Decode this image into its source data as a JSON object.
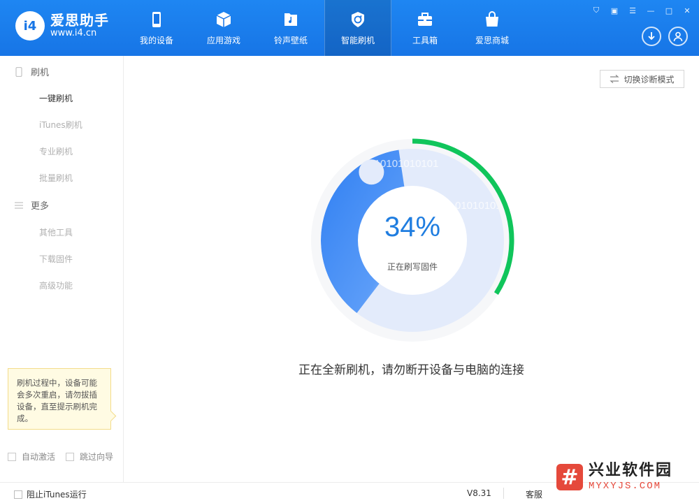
{
  "app": {
    "brand": "爱思助手",
    "url": "www.i4.cn",
    "logo_mark": "i4",
    "accent": "#1775e6"
  },
  "nav": {
    "tabs": [
      {
        "label": "我的设备",
        "icon": "phone-icon"
      },
      {
        "label": "应用游戏",
        "icon": "cube-icon"
      },
      {
        "label": "铃声壁纸",
        "icon": "music-file-icon"
      },
      {
        "label": "智能刷机",
        "icon": "refresh-shield-icon",
        "active": true
      },
      {
        "label": "工具箱",
        "icon": "toolbox-icon"
      },
      {
        "label": "爱思商城",
        "icon": "shopping-bag-icon"
      }
    ]
  },
  "window_controls": [
    "shirt-icon",
    "note-icon",
    "menu-icon",
    "minimize-icon",
    "maximize-icon",
    "close-icon"
  ],
  "sidebar": {
    "flash_section": "刷机",
    "flash_items": [
      "一键刷机",
      "iTunes刷机",
      "专业刷机",
      "批量刷机"
    ],
    "more_section": "更多",
    "more_items": [
      "其他工具",
      "下载固件",
      "高级功能"
    ],
    "tip": "刷机过程中，设备可能会多次重启，请勿拔插设备，直至提示刷机完成。",
    "auto_activate": "自动激活",
    "skip_guide": "跳过向导"
  },
  "main": {
    "diag_button": "切换诊断模式",
    "progress_percent": 34,
    "progress_text": "34%",
    "status": "正在刷写固件",
    "binary_text_1": "1010101010101",
    "binary_text_2": "01010101",
    "message": "正在全新刷机，请勿断开设备与电脑的连接",
    "colors": {
      "progress": "#10c55b",
      "ring_fill": "#3d8af7",
      "ring_bg": "#e3ebfb"
    }
  },
  "footer": {
    "block_itunes": "阻止iTunes运行",
    "version": "V8.31",
    "service": "客服"
  },
  "watermark": {
    "badge": "#",
    "cn": "兴业软件园",
    "en": "MYXYJS.COM"
  }
}
